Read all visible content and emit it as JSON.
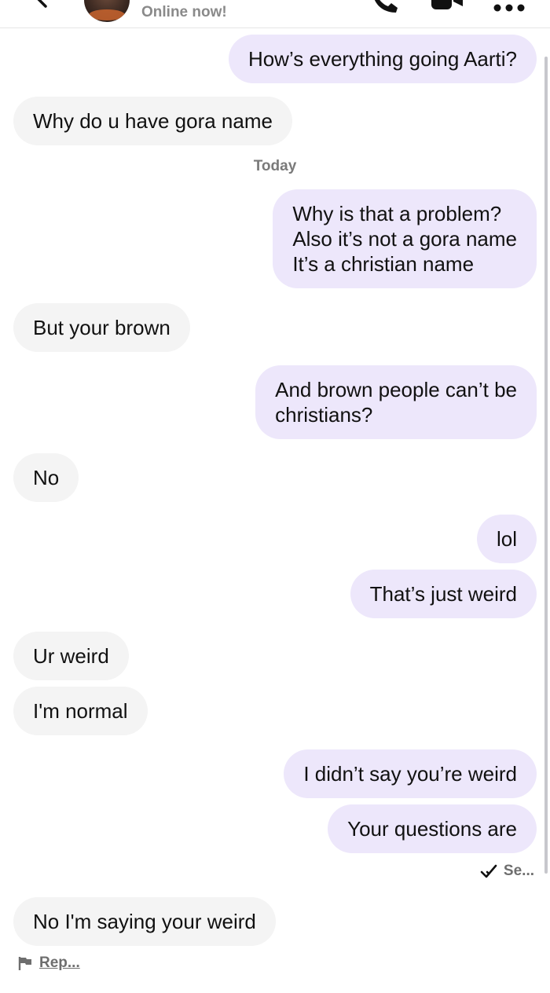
{
  "header": {
    "status": "Online now!",
    "icons": [
      "back-chevron-icon",
      "avatar",
      "phone-icon",
      "video-camera-icon",
      "more-icon"
    ]
  },
  "conversation": {
    "day_label": "Today",
    "messages": [
      {
        "from": "me",
        "text": "How’s everything going Aarti?"
      },
      {
        "from": "them",
        "text": "Why do u have gora name"
      },
      {
        "from": "me",
        "text": "Why is that a problem?\nAlso it’s not a gora name\nIt’s a christian name"
      },
      {
        "from": "them",
        "text": "But your brown"
      },
      {
        "from": "me",
        "text": "And brown people can’t be\nchristians?"
      },
      {
        "from": "them",
        "text": "No"
      },
      {
        "from": "me",
        "text": "lol"
      },
      {
        "from": "me",
        "text": "That’s just weird"
      },
      {
        "from": "them",
        "text": "Ur weird"
      },
      {
        "from": "them",
        "text": "I'm normal"
      },
      {
        "from": "me",
        "text": "I didn’t say you’re weird"
      },
      {
        "from": "me",
        "text": "Your questions are"
      },
      {
        "from": "them",
        "text": "No I'm saying your weird"
      }
    ],
    "seen_label": "Se...",
    "report_label": "Rep..."
  },
  "colors": {
    "incoming_bubble": "#f4f4f4",
    "outgoing_bubble": "#ede7fb",
    "meta_text": "#7a7a7a"
  }
}
